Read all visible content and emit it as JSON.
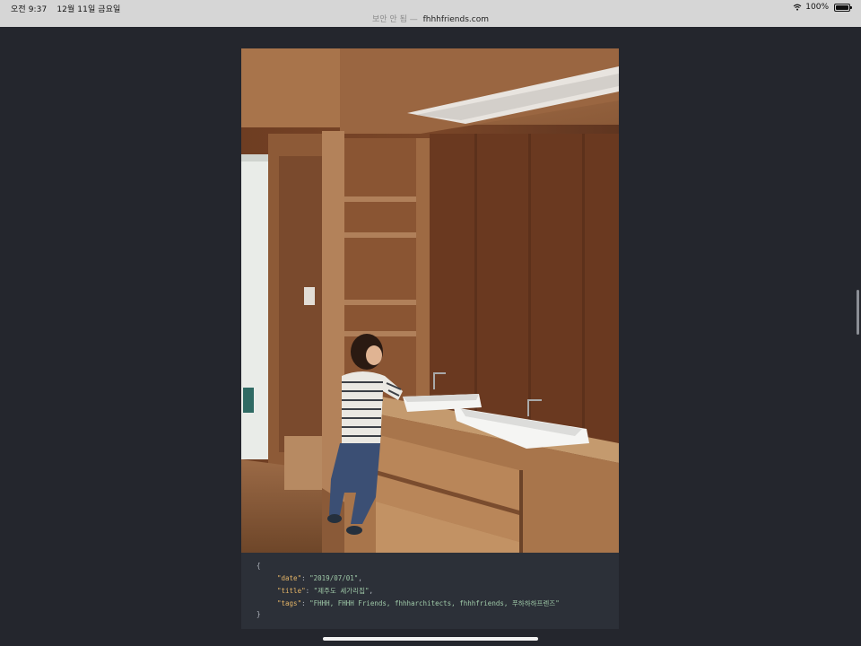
{
  "status_bar": {
    "time": "오전 9:37",
    "date": "12월 11일 금요일",
    "security": "보안 안 됨 —",
    "domain": "fhhhfriends.com",
    "battery": "100%",
    "icons": [
      "wifi-icon",
      "battery-icon"
    ]
  },
  "photo": {
    "description_icon": "photo-image"
  },
  "code": {
    "open_brace": "{",
    "close_brace": "}",
    "lines": [
      {
        "key": "\"date\"",
        "value": "\"2019/07/01\"",
        "sep": ": ",
        "end": ","
      },
      {
        "key": "\"title\"",
        "value": "\"제주도 세가리집\"",
        "sep": ": ",
        "end": ","
      },
      {
        "key": "\"tags\"",
        "value": "\"FHHH, FHHH Friends, fhhharchitects, fhhhfriends, 푸하하하프렌즈\"",
        "sep": ": ",
        "end": ""
      }
    ]
  },
  "colors": {
    "background": "#24262d",
    "status_bar": "#d6d6d6",
    "code_bg": "#2c3038",
    "code_key": "#e5b567",
    "code_string": "#9fc9a8"
  }
}
